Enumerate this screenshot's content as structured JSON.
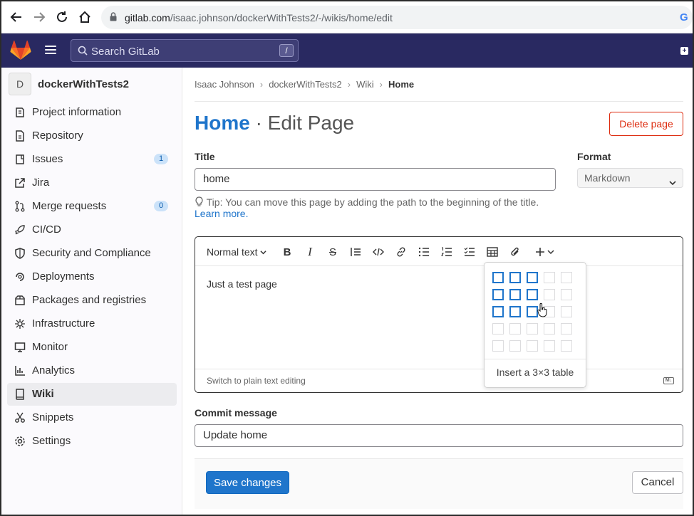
{
  "browser": {
    "url_host": "gitlab.com",
    "url_path": "/isaac.johnson/dockerWithTests2/-/wikis/home/edit"
  },
  "header": {
    "search_placeholder": "Search GitLab",
    "search_shortcut": "/"
  },
  "sidebar": {
    "project_avatar": "D",
    "project_name": "dockerWithTests2",
    "items": [
      {
        "label": "Project information",
        "icon": "info-icon"
      },
      {
        "label": "Repository",
        "icon": "document-icon"
      },
      {
        "label": "Issues",
        "icon": "issues-icon",
        "badge": "1"
      },
      {
        "label": "Jira",
        "icon": "external-link-icon"
      },
      {
        "label": "Merge requests",
        "icon": "merge-request-icon",
        "badge": "0"
      },
      {
        "label": "CI/CD",
        "icon": "rocket-icon"
      },
      {
        "label": "Security and Compliance",
        "icon": "shield-icon"
      },
      {
        "label": "Deployments",
        "icon": "deployments-icon"
      },
      {
        "label": "Packages and registries",
        "icon": "package-icon"
      },
      {
        "label": "Infrastructure",
        "icon": "cloud-gear-icon"
      },
      {
        "label": "Monitor",
        "icon": "monitor-icon"
      },
      {
        "label": "Analytics",
        "icon": "chart-icon"
      },
      {
        "label": "Wiki",
        "icon": "book-icon",
        "active": true
      },
      {
        "label": "Snippets",
        "icon": "scissors-icon"
      },
      {
        "label": "Settings",
        "icon": "gear-icon"
      }
    ]
  },
  "breadcrumb": [
    "Isaac Johnson",
    "dockerWithTests2",
    "Wiki",
    "Home"
  ],
  "page": {
    "title_main": "Home",
    "title_rest": " · Edit Page",
    "delete_label": "Delete page"
  },
  "form": {
    "title_label": "Title",
    "title_value": "home",
    "format_label": "Format",
    "format_value": "Markdown",
    "tip_text": "Tip: You can move this page by adding the path to the beginning of the title.",
    "tip_link": "Learn more.",
    "commit_label": "Commit message",
    "commit_value": "Update home",
    "save_label": "Save changes",
    "cancel_label": "Cancel"
  },
  "editor": {
    "text_style": "Normal text",
    "body_text": "Just a test page",
    "switch_label": "Switch to plain text editing",
    "md_badge": "M↓"
  },
  "table_popover": {
    "insert_label": "Insert a 3×3 table",
    "selected_rows": 3,
    "selected_cols": 3,
    "grid_rows": 5,
    "grid_cols": 5
  },
  "colors": {
    "header_bg": "#292961",
    "accent": "#1f75cb",
    "danger": "#dd2b0e"
  }
}
